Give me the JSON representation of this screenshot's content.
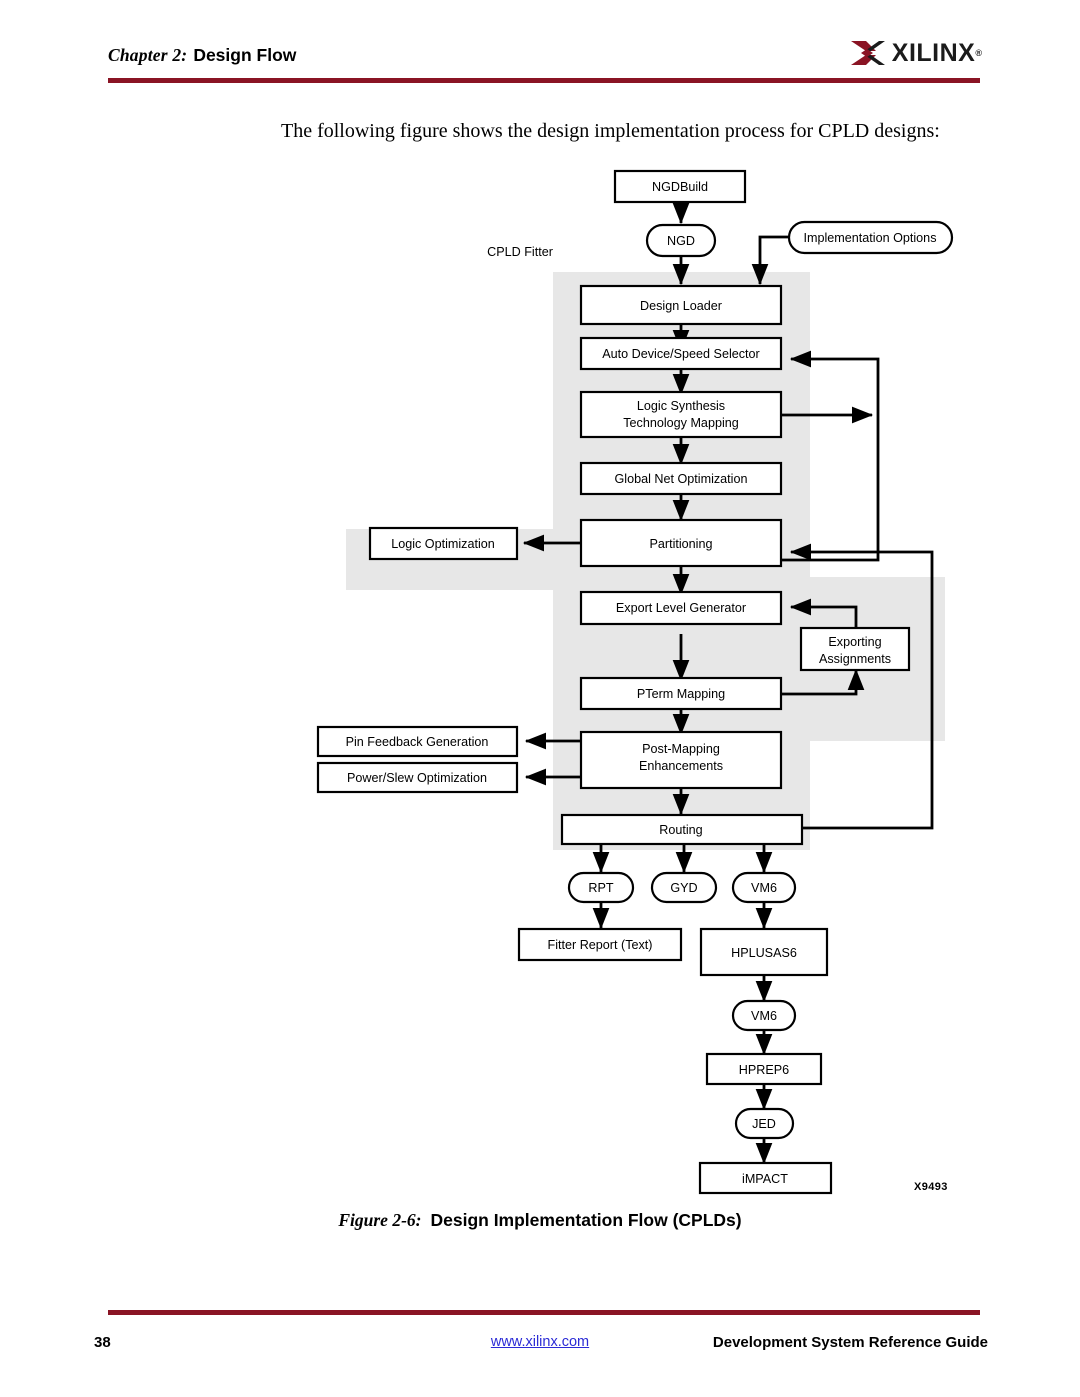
{
  "header": {
    "chapter_label": "Chapter 2:",
    "chapter_title": "Design Flow",
    "logo_word": "XILINX",
    "logo_registered": "®",
    "rule_color": "#8a1424"
  },
  "intro": {
    "text": "The following figure shows the design implementation process for CPLD designs:"
  },
  "figure": {
    "caption_label": "Figure 2-6:",
    "caption_title": "Design Implementation Flow (CPLDs)",
    "figure_id": "X9493",
    "group_label": "CPLD Fitter",
    "gray_fill": "#e7e7e7",
    "nodes": [
      {
        "id": "ngdbuild",
        "label": "NGDBuild",
        "shape": "rect"
      },
      {
        "id": "ngd",
        "label": "NGD",
        "shape": "stadium"
      },
      {
        "id": "implopts",
        "label": "Implementation Options",
        "shape": "stadium"
      },
      {
        "id": "designloader",
        "label": "Design Loader",
        "shape": "rect"
      },
      {
        "id": "autodevice",
        "label": "Auto Device/Speed Selector",
        "shape": "rect"
      },
      {
        "id": "logicsynth",
        "label": "Logic Synthesis",
        "label2": "Technology Mapping",
        "shape": "rect"
      },
      {
        "id": "globalnet",
        "label": "Global Net Optimization",
        "shape": "rect"
      },
      {
        "id": "partitioning",
        "label": "Partitioning",
        "shape": "rect"
      },
      {
        "id": "logicopt",
        "label": "Logic Optimization",
        "shape": "rect"
      },
      {
        "id": "exportlevel",
        "label": "Export Level Generator",
        "shape": "rect"
      },
      {
        "id": "exportassign",
        "label": "Exporting",
        "label2": "Assignments",
        "shape": "rect"
      },
      {
        "id": "ptermmap",
        "label": "PTerm Mapping",
        "shape": "rect"
      },
      {
        "id": "postmap",
        "label": "Post-Mapping",
        "label2": "Enhancements",
        "shape": "rect"
      },
      {
        "id": "pinfeedback",
        "label": "Pin Feedback Generation",
        "shape": "rect"
      },
      {
        "id": "powerslew",
        "label": "Power/Slew Optimization",
        "shape": "rect"
      },
      {
        "id": "routing",
        "label": "Routing",
        "shape": "rect"
      },
      {
        "id": "rpt",
        "label": "RPT",
        "shape": "stadium"
      },
      {
        "id": "gyd",
        "label": "GYD",
        "shape": "stadium"
      },
      {
        "id": "vm6a",
        "label": "VM6",
        "shape": "stadium"
      },
      {
        "id": "fitterreport",
        "label": "Fitter Report (Text)",
        "shape": "rect"
      },
      {
        "id": "hplusas6",
        "label": "HPLUSAS6",
        "shape": "rect"
      },
      {
        "id": "vm6b",
        "label": "VM6",
        "shape": "stadium"
      },
      {
        "id": "hprep6",
        "label": "HPREP6",
        "shape": "rect"
      },
      {
        "id": "jed",
        "label": "JED",
        "shape": "stadium"
      },
      {
        "id": "impact",
        "label": "iMPACT",
        "shape": "rect"
      }
    ],
    "edges": [
      {
        "from": "ngdbuild",
        "to": "ngd"
      },
      {
        "from": "ngd",
        "to": "designloader"
      },
      {
        "from": "implopts",
        "to": "designloader"
      },
      {
        "from": "designloader",
        "to": "autodevice"
      },
      {
        "from": "autodevice",
        "to": "logicsynth"
      },
      {
        "from": "logicsynth",
        "to": "globalnet"
      },
      {
        "from": "globalnet",
        "to": "partitioning"
      },
      {
        "from": "partitioning",
        "to": "logicopt"
      },
      {
        "from": "partitioning",
        "to": "autodevice"
      },
      {
        "from": "logicsynth",
        "to": "feedback-bus"
      },
      {
        "from": "partitioning",
        "to": "exportlevel"
      },
      {
        "from": "exportlevel",
        "to": "ptermmap"
      },
      {
        "from": "ptermmap",
        "to": "exportassign"
      },
      {
        "from": "exportassign",
        "to": "exportlevel"
      },
      {
        "from": "ptermmap",
        "to": "postmap"
      },
      {
        "from": "postmap",
        "to": "pinfeedback"
      },
      {
        "from": "postmap",
        "to": "powerslew"
      },
      {
        "from": "postmap",
        "to": "routing"
      },
      {
        "from": "routing",
        "to": "partitioning"
      },
      {
        "from": "routing",
        "to": "rpt"
      },
      {
        "from": "routing",
        "to": "gyd"
      },
      {
        "from": "routing",
        "to": "vm6a"
      },
      {
        "from": "rpt",
        "to": "fitterreport"
      },
      {
        "from": "vm6a",
        "to": "hplusas6"
      },
      {
        "from": "hplusas6",
        "to": "vm6b"
      },
      {
        "from": "vm6b",
        "to": "hprep6"
      },
      {
        "from": "hprep6",
        "to": "jed"
      },
      {
        "from": "jed",
        "to": "impact"
      }
    ]
  },
  "footer": {
    "page_number": "38",
    "url": "www.xilinx.com",
    "guide_title": "Development System Reference Guide",
    "url_color": "#2b2bd6"
  }
}
